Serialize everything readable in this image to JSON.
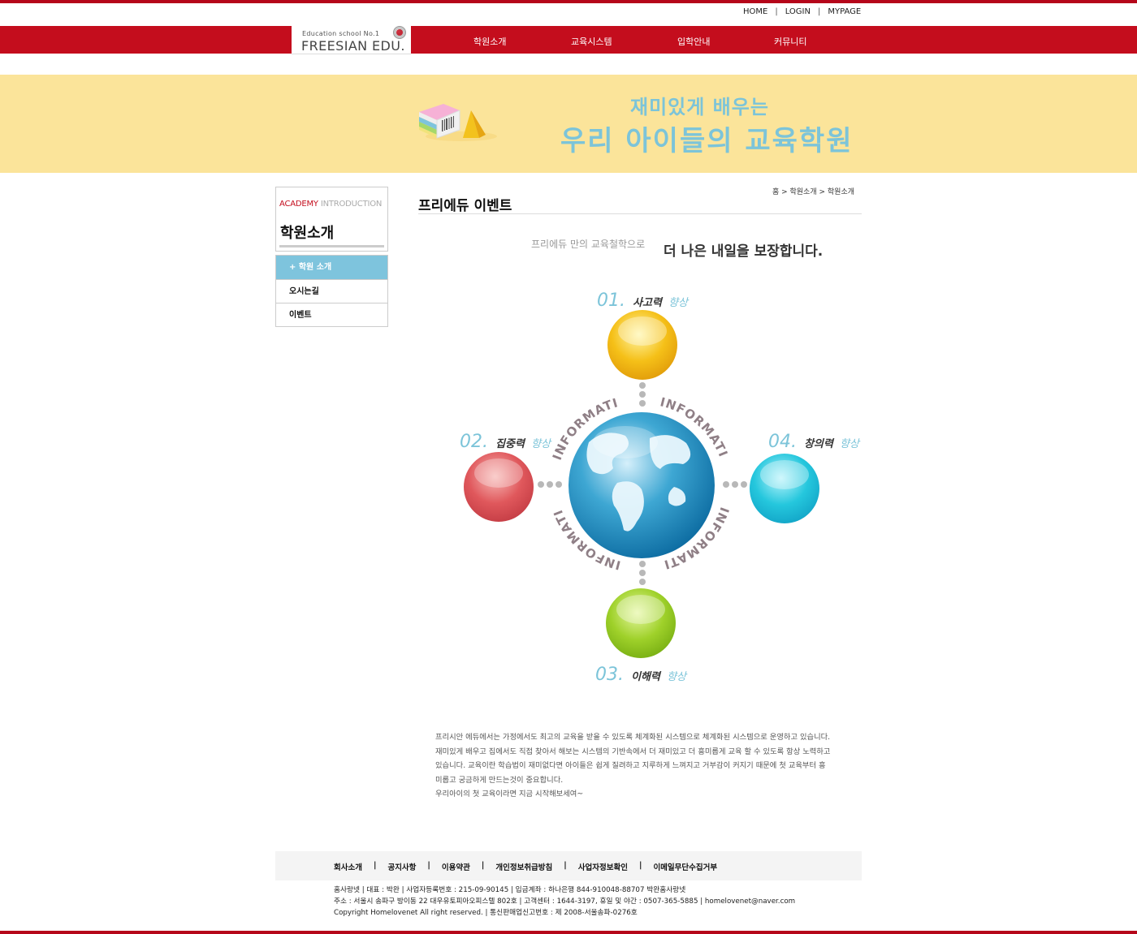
{
  "header": {
    "util_links": [
      "HOME",
      "LOGIN",
      "MYPAGE"
    ],
    "logo_small": "Education school No.1",
    "logo_big": "FREESIAN EDU.",
    "menu": [
      "학원소개",
      "교육시스템",
      "입학안내",
      "커뮤니티"
    ]
  },
  "banner": {
    "line1": "재미있게 배우는",
    "line2": "우리 아이들의 교육학원"
  },
  "sidebar": {
    "en_red": "ACADEMY",
    "en_grey": " INTRODUCTION",
    "title": "학원소개",
    "items": [
      "+ 학원 소개",
      "오시는길",
      "이벤트"
    ]
  },
  "content": {
    "breadcrumb": "홈 > 학원소개 > 학원소개",
    "title": "프리에듀 이벤트",
    "slogan_light": "프리에듀 만의 교육철학으로",
    "slogan_bold": "더 나은 내일을 보장합니다."
  },
  "diagram": {
    "center_text": "INFORMATION",
    "nodes": [
      {
        "num": "01.",
        "label": "사고력",
        "suffix": "향상",
        "color": "#f5c018"
      },
      {
        "num": "02.",
        "label": "집중력",
        "suffix": "향상",
        "color": "#e0585c"
      },
      {
        "num": "03.",
        "label": "이해력",
        "suffix": "향상",
        "color": "#9fd12a"
      },
      {
        "num": "04.",
        "label": "창의력",
        "suffix": "향상",
        "color": "#25c7dd"
      }
    ]
  },
  "body_text": [
    "프리시안 에듀에서는 가정에서도 최고의 교육을 받을 수 있도록 체계화된 시스템으로 체계화된 시스템으로 운영하고 있습니다.",
    "재미있게 배우고 집에서도 직접 찾아서 해보는 시스템의 기반속에서 더 재미있고 더 흥미롭게 교육 할 수 있도록 항상 노력하고",
    "있습니다.  교육이란 학습법이 재미없다면 아이들은 쉽게 질려하고 지루하게 느껴지고 거부감이 커지기 때문에 첫 교육부터 흥",
    "미롭고 궁금하게 만드는것이 중요합니다.",
    "우리아이의 첫 교육이라면 지금 시작해보세여~"
  ],
  "footer": {
    "links": [
      "회사소개",
      "공지사항",
      "이용약관",
      "개인정보취급방침",
      "사업자정보확인",
      "이메일무단수집거부"
    ],
    "info": [
      "홈사랑넷  |  대표 : 박완  |  사업자등록번호 : 215-09-90145  |  입금계좌 : 하나은행 844-910048-88707 박완홈사랑넷",
      "주소 : 서울시 송파구 방이동 22 대우유토피아오피스텔 802호  |  고객센터 : 1644-3197, 휴일 및 야간 : 0507-365-5885  |  homelovenet@naver.com",
      "Copyright Homelovenet All right reserved.  |  통신판매업신고번호 : 제 2008-서울송파-0276호"
    ]
  },
  "colors": {
    "brand_red": "#c40d1d",
    "banner_yellow": "#fbe49a",
    "accent_blue": "#7cc4d9"
  }
}
